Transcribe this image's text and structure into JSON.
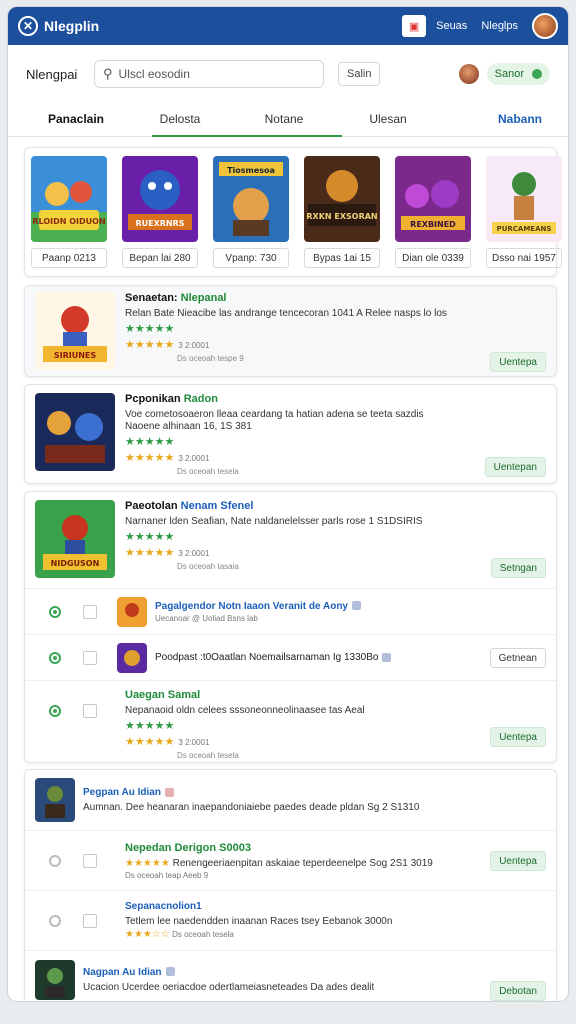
{
  "header": {
    "app_name": "Nlegplin",
    "action_icon": "image-icon",
    "link1": "Seuas",
    "link2": "Nleglps"
  },
  "searchbar": {
    "label": "Nlengpai",
    "placeholder": "Ulscl eosodin",
    "button": "Salin",
    "sign": "Sanor"
  },
  "tabs": [
    {
      "label": "Panaclain",
      "active": true
    },
    {
      "label": "Delosta",
      "active": false
    },
    {
      "label": "Notane",
      "active": false
    },
    {
      "label": "Ulesan",
      "active": false
    },
    {
      "label": "Nabann",
      "active": false
    }
  ],
  "shelf": [
    {
      "title": "RLOIDN OIDUON",
      "price": "Paanp 0213"
    },
    {
      "title": "RUEXRNRS",
      "price": "Bepan lai 280"
    },
    {
      "title": "Tiosmesoa",
      "price": "Vpanp: 730"
    },
    {
      "title": "RXKN EXSORAN",
      "price": "Bypas 1ai 15"
    },
    {
      "title": "REXBINED",
      "price": "Dian ole 0339"
    },
    {
      "title": "PURCAMEANS",
      "price": "Dsso nai 1957"
    }
  ],
  "items": [
    {
      "title_a": "Senaetan:",
      "title_b": "Nlepanal",
      "desc": "Relan Bate Nieacibe las andrange tencecoran 1041 A Relee nasps lo los",
      "stars_green": "★★★★★",
      "stars_yellow": "★★★★★",
      "meta1": "3 2:0001",
      "meta2": "Ds oceoah tespe 9",
      "button": "Uentepa",
      "thumb_label": "SIRIUNES"
    },
    {
      "title_a": "Pcponikan",
      "title_b": "Radon",
      "desc": "Voe cometosoaeron lleaa ceardang ta hatian adena se teeta sazdis",
      "desc2": "Naoene alhinaan  16, 1S 381",
      "stars_green": "★★★★★",
      "stars_yellow": "★★★★★",
      "meta1": "3 2:0001",
      "meta2": "Ds oceoah tesela",
      "button": "Uentepan",
      "thumb_label": ""
    },
    {
      "title_a": "Paeotolan",
      "title_b": "Nenam Sfenel",
      "desc": "Narnaner lden Seafian, Nate naldanelelsser parls rose 1 S1DSIRIS",
      "stars_green": "★★★★★",
      "stars_yellow": "★★★★★",
      "meta1": "3 2:0001",
      "meta2": "Ds oceoah tasaia",
      "button": "Setngan",
      "thumb_label": "NIDGUSON"
    }
  ],
  "subrows": [
    {
      "title": "Pagalgendor Notn Iaaon Veranit de Aony",
      "sub": "Uecanoar  @ Uoliad Bsns lab",
      "button": ""
    },
    {
      "title": "Poodpast :t0Oaatlan Noemailsarnaman Ig 1330Bo",
      "sub": "",
      "button": "Getnean"
    },
    {
      "title": "Uaegan Samal",
      "sub": "Nepanaoid oldn celees sssoneonneolinaasee tas Aeal",
      "stars_green": "★★★★★",
      "stars_yellow": "★★★★★",
      "meta1": "3 2:0001",
      "meta2": "Ds oceoah tesela",
      "button": "Uentepa"
    }
  ],
  "bottom": [
    {
      "title": "Pegpan Au Idian",
      "sub": "Aumnan. Dee heanaran inaepandoniaiebe paedes deade pldan Sg 2 S1310",
      "button": ""
    },
    {
      "title": "Nepedan Derigon S0003",
      "sub": "Renengeeriaenpitan askaiae teperdeenelpe Sog 2S1 3019",
      "meta": "Ds oceoah teap Aeeb 9",
      "button": "Uentepa"
    },
    {
      "title": "Sepanacnolion1",
      "sub": "Tetlem lee naedendden inaanan Races tsey Eebanok 3000n",
      "meta": "Ds oceoah tesela",
      "button": ""
    },
    {
      "title": "Nagpan Au Idian",
      "sub": "Ucacion Ucerdee oeriacdoe odertlameiasneteades Da ades dealit",
      "button": "Debotan"
    }
  ],
  "colors": {
    "brand": "#1c4f9c",
    "accent": "#2f9a45",
    "star": "#e7a81d"
  }
}
